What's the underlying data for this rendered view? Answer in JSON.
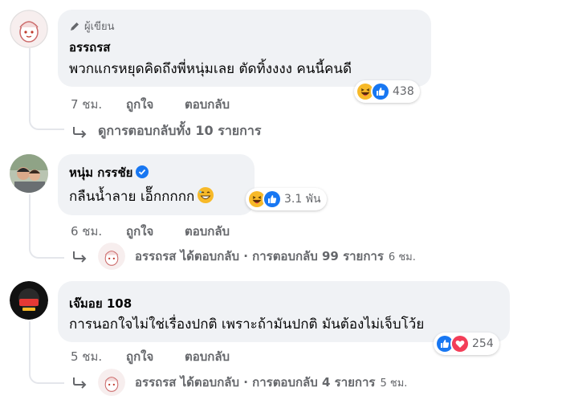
{
  "comments": [
    {
      "badge": "ผู้เขียน",
      "name": "อรรถรส",
      "text": "พวกแกรหยุดคิดถึงพี่หนุ่มเลย ตัดทิ้งงงง คนนี้คนดี",
      "reaction_count": "438",
      "time": "7 ชม.",
      "like_label": "ถูกใจ",
      "reply_label": "ตอบกลับ",
      "view_replies": "ดูการตอบกลับทั้ง 10 รายการ"
    },
    {
      "name": "หนุ่ม กรรชัย",
      "text": "กลืนน้ำลาย เอ็๊กกกกก",
      "reaction_count": "3.1 พัน",
      "time": "6 ชม.",
      "like_label": "ถูกใจ",
      "reply_label": "ตอบกลับ",
      "reply_summary": "อรรถรส ได้ตอบกลับ · การตอบกลับ 99 รายการ",
      "reply_time": "6 ชม."
    },
    {
      "name": "เจ๊มอย 108",
      "text": "การนอกใจไม่ใช่เรื่องปกติ เพราะถ้ามันปกติ มันต้องไม่เจ็บโว้ย",
      "reaction_count": "254",
      "time": "5 ชม.",
      "like_label": "ถูกใจ",
      "reply_label": "ตอบกลับ",
      "reply_summary": "อรรถรส ได้ตอบกลับ · การตอบกลับ 4 รายการ",
      "reply_time": "5 ชม."
    }
  ],
  "icons": {
    "author": "pen-icon",
    "reactions": [
      "haha-reaction-icon",
      "like-reaction-icon",
      "love-reaction-icon"
    ],
    "verified": "verified-badge-icon",
    "reply": "reply-arrow-icon"
  },
  "colors": {
    "bubble": "#f0f2f5",
    "secondary_text": "#65676b",
    "like_blue": "#1877f2",
    "love_red": "#f33e58",
    "haha_yellow": "#f7b928"
  }
}
